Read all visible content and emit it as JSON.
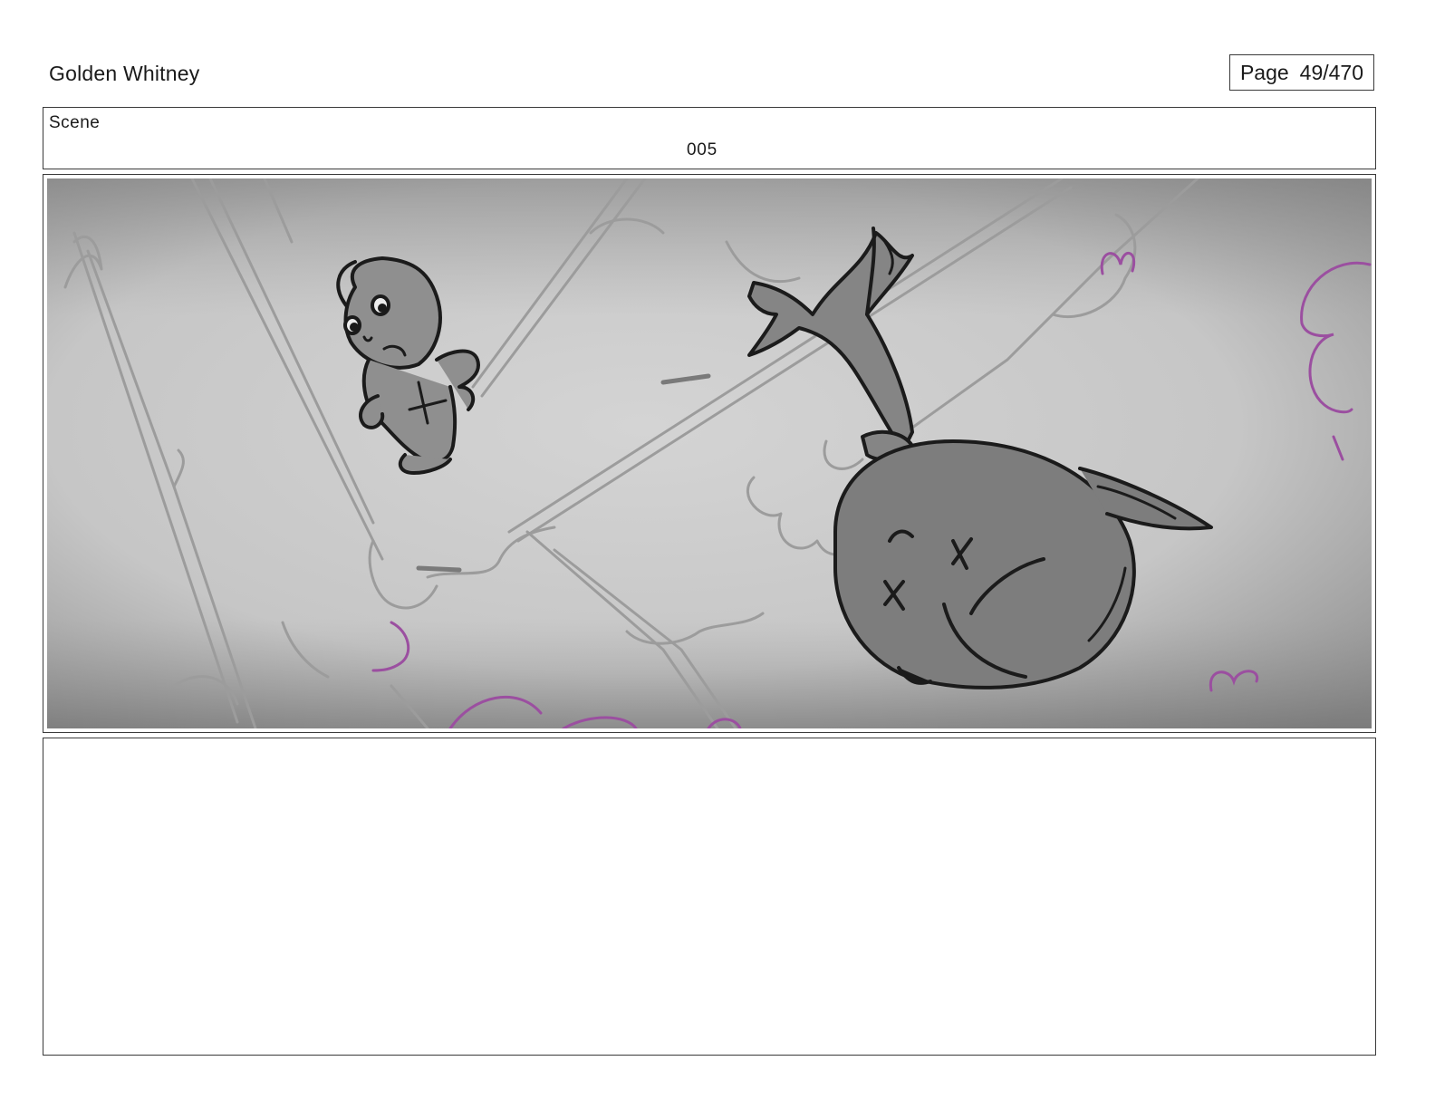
{
  "header": {
    "project_title": "Golden Whitney",
    "page_label": "Page",
    "page_number": "49/470"
  },
  "scene": {
    "label": "Scene",
    "number": "005"
  },
  "panel": {
    "description_icon": "storyboard-sketch",
    "colors": {
      "background_light": "#d2d2d2",
      "background_dark": "#8f8f8f",
      "ink": "#1b1b1b",
      "sketch_grey": "#9a9a9a",
      "accent_purple": "#9b4fa0"
    }
  },
  "notes": {
    "text": ""
  }
}
